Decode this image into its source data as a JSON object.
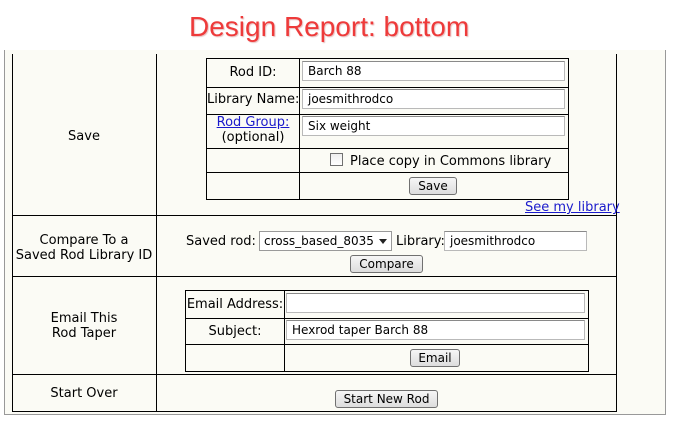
{
  "page_title": "Design Report: bottom",
  "save_section": {
    "label": "Save",
    "rod_id_label": "Rod ID:",
    "rod_id_value": "Barch 88",
    "library_name_label": "Library Name:",
    "library_name_value": "joesmithrodco",
    "rod_group_link": "Rod Group:",
    "rod_group_optional": "(optional)",
    "rod_group_value": "Six weight",
    "commons_checkbox_label": "Place copy in Commons library",
    "commons_checked": false,
    "save_button": "Save",
    "see_library_link": "See my library"
  },
  "compare_section": {
    "label_line1": "Compare To a",
    "label_line2": "Saved Rod Library ID",
    "saved_rod_label": "Saved rod:",
    "saved_rod_value": "cross_based_8035",
    "library_label": "Library:",
    "library_value": "joesmithrodco",
    "compare_button": "Compare"
  },
  "email_section": {
    "label_line1": "Email This",
    "label_line2": "Rod Taper",
    "email_address_label": "Email Address:",
    "email_address_value": "",
    "subject_label": "Subject:",
    "subject_value": "Hexrod taper Barch 88",
    "email_button": "Email"
  },
  "start_over_section": {
    "label": "Start Over",
    "start_new_button": "Start New Rod"
  }
}
